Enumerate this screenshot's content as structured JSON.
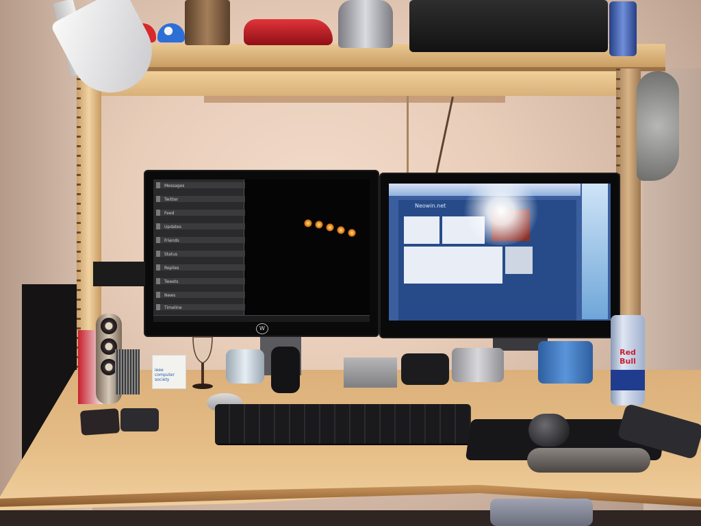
{
  "photo": {
    "subject": "home office desk",
    "left_monitor": {
      "brand_mark": "W",
      "app_labels": [
        "Messages",
        "Twitter",
        "Feed",
        "Updates",
        "Friends",
        "Status",
        "Replies",
        "Tweets",
        "News",
        "Timeline"
      ]
    },
    "right_monitor": {
      "site_logo": "Neowin.net"
    },
    "ieee_box": [
      "ieee",
      "computer",
      "society"
    ],
    "can_label": "Red Bull",
    "colors": {
      "desk": "#e2b981",
      "wall": "#efd6c4",
      "accent_red": "#c81f2e",
      "accent_blue": "#1f3c8e"
    }
  }
}
